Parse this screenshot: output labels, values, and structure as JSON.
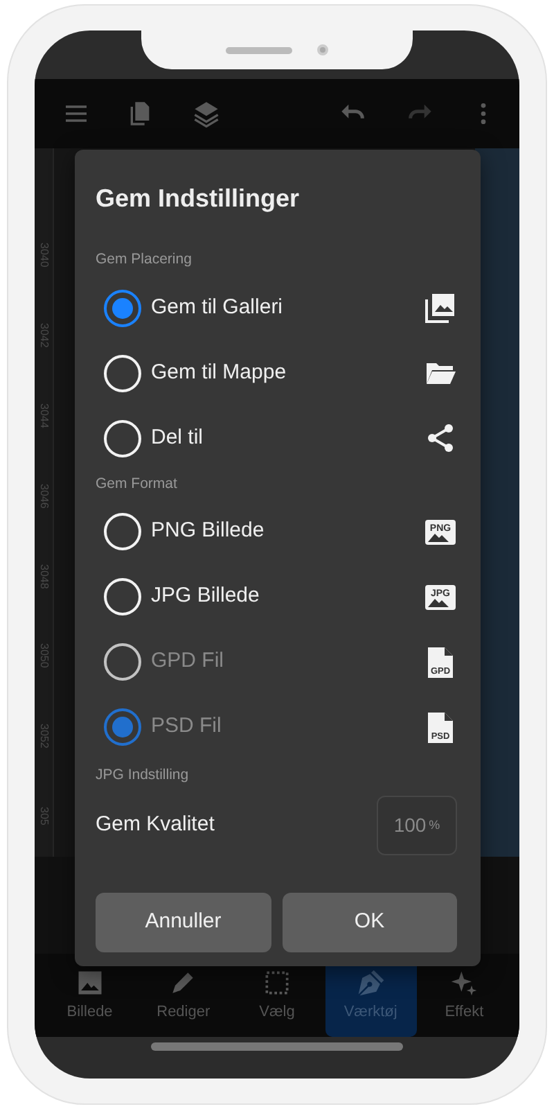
{
  "ruler_labels": [
    "3040",
    "3042",
    "3044",
    "3046",
    "3048",
    "3050",
    "3052",
    "305"
  ],
  "dialog": {
    "title": "Gem Indstillinger",
    "sections": [
      {
        "heading": "Gem Placering",
        "options": [
          {
            "label": "Gem til Galleri",
            "selected": true,
            "disabled": false,
            "kind": "gallery"
          },
          {
            "label": "Gem til Mappe",
            "selected": false,
            "disabled": false,
            "kind": "folder"
          },
          {
            "label": "Del til",
            "selected": false,
            "disabled": false,
            "kind": "share"
          }
        ]
      },
      {
        "heading": "Gem Format",
        "options": [
          {
            "label": "PNG Billede",
            "selected": false,
            "disabled": false,
            "kind": "image-file",
            "icon_text": "PNG"
          },
          {
            "label": "JPG Billede",
            "selected": false,
            "disabled": false,
            "kind": "image-file",
            "icon_text": "JPG"
          },
          {
            "label": "GPD Fil",
            "selected": false,
            "disabled": true,
            "kind": "document-file",
            "icon_text": "GPD"
          },
          {
            "label": "PSD Fil",
            "selected": true,
            "disabled": true,
            "kind": "document-file",
            "icon_text": "PSD"
          }
        ]
      }
    ],
    "quality": {
      "heading": "JPG Indstilling",
      "label": "Gem Kvalitet",
      "value": "100",
      "unit": "%"
    },
    "buttons": [
      "Annuller",
      "OK"
    ]
  },
  "bottom_nav": [
    {
      "label": "Billede",
      "selected": false,
      "kind": "image"
    },
    {
      "label": "Rediger",
      "selected": false,
      "kind": "pencil"
    },
    {
      "label": "Vælg",
      "selected": false,
      "kind": "select"
    },
    {
      "label": "Værktøj",
      "selected": true,
      "kind": "pen"
    },
    {
      "label": "Effekt",
      "selected": false,
      "kind": "sparkle"
    }
  ]
}
